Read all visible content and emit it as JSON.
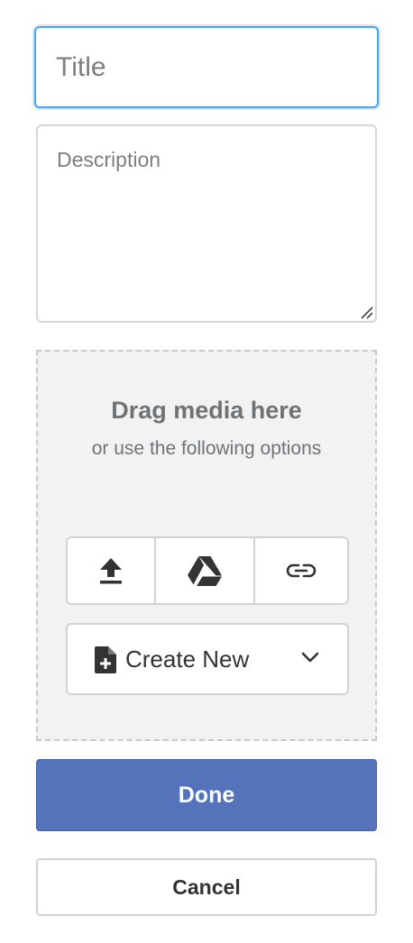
{
  "form": {
    "title_placeholder": "Title",
    "title_value": "",
    "description_placeholder": "Description",
    "description_value": ""
  },
  "dropzone": {
    "heading": "Drag media here",
    "subheading": "or use the following options",
    "sources": [
      {
        "icon": "upload-icon"
      },
      {
        "icon": "google-drive-icon"
      },
      {
        "icon": "link-icon"
      }
    ],
    "create_new": {
      "label": "Create New",
      "icon": "new-document-icon",
      "dropdown_icon": "chevron-down-icon"
    }
  },
  "actions": {
    "done_label": "Done",
    "cancel_label": "Cancel"
  },
  "colors": {
    "focus_border": "#4da3ec",
    "primary": "#5473ba",
    "dropzone_bg": "#f2f2f2",
    "muted_text": "#6e7378"
  }
}
